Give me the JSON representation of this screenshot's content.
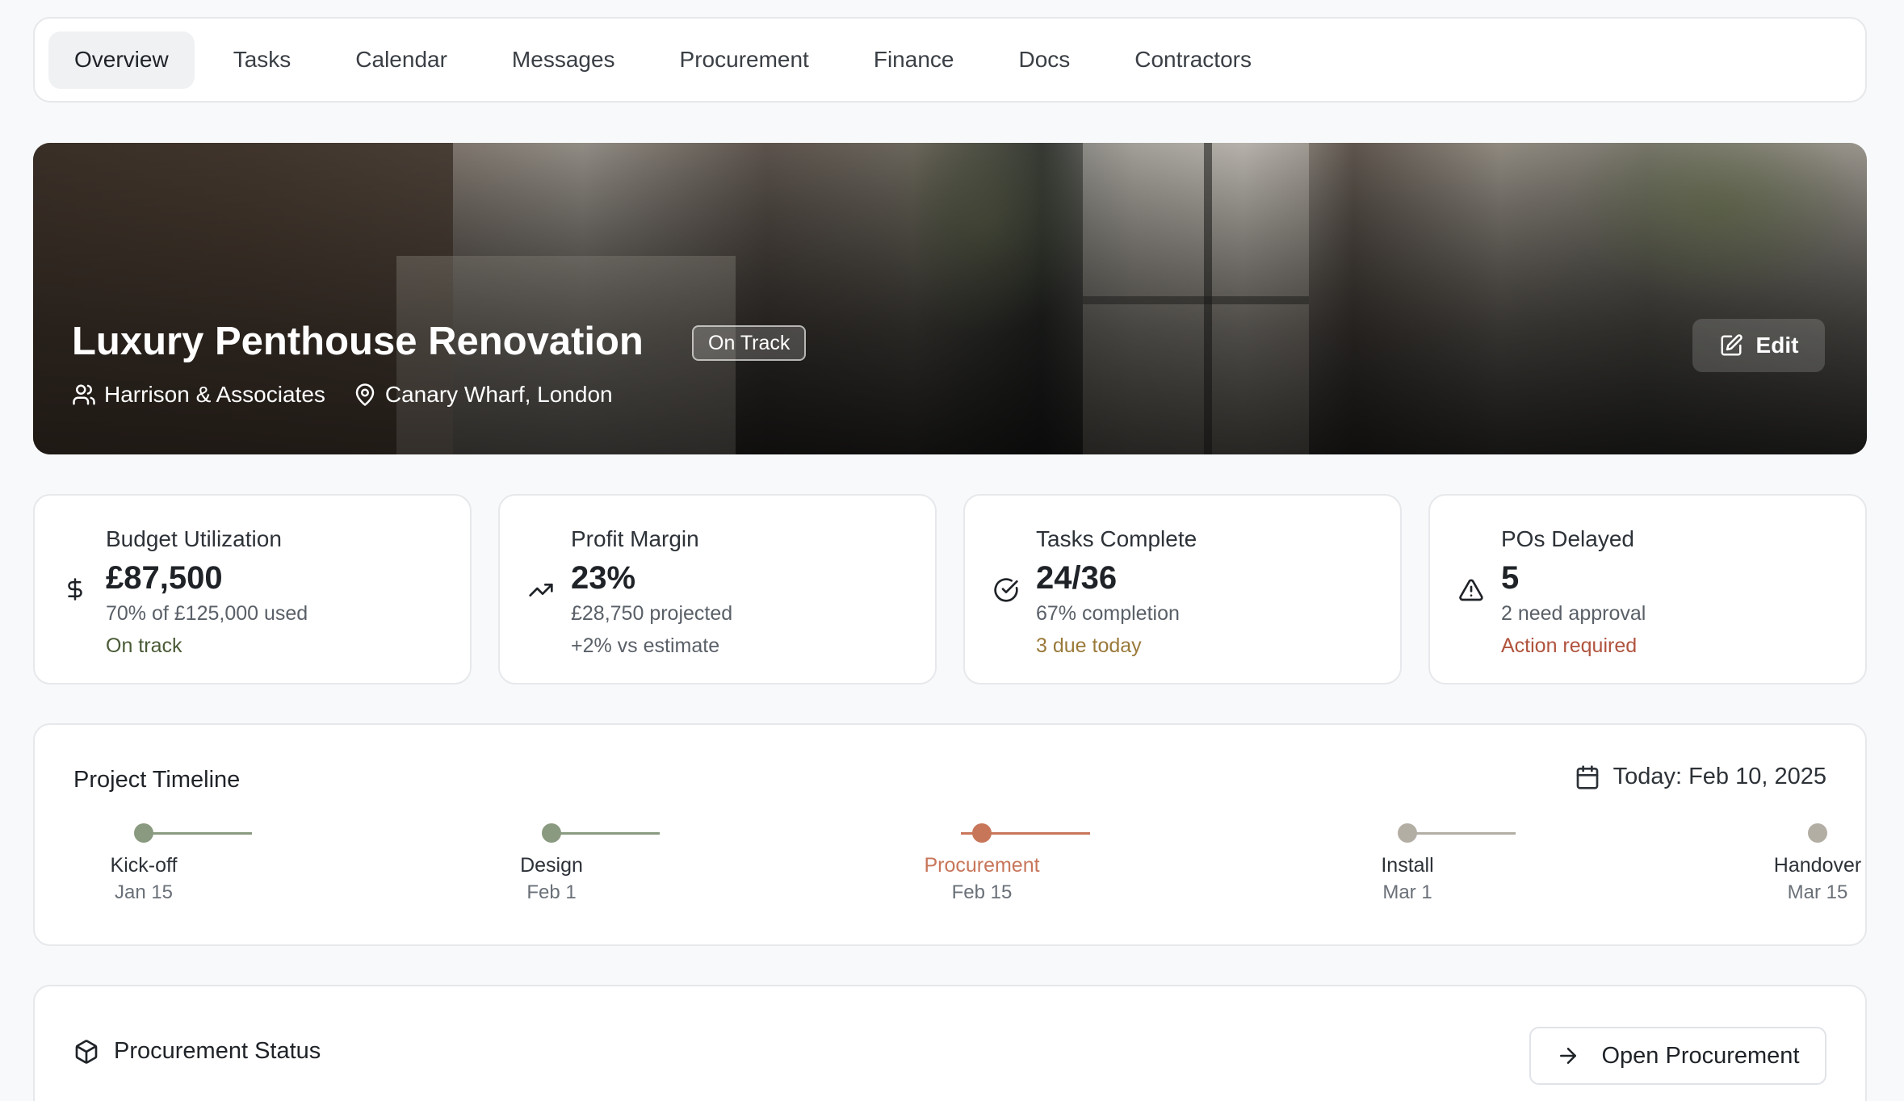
{
  "tabs": [
    {
      "label": "Overview",
      "active": true
    },
    {
      "label": "Tasks"
    },
    {
      "label": "Calendar"
    },
    {
      "label": "Messages"
    },
    {
      "label": "Procurement"
    },
    {
      "label": "Finance"
    },
    {
      "label": "Docs"
    },
    {
      "label": "Contractors"
    }
  ],
  "hero": {
    "title": "Luxury Penthouse Renovation",
    "status": "On Track",
    "client": "Harrison & Associates",
    "location": "Canary Wharf, London",
    "edit_label": "Edit"
  },
  "stats": [
    {
      "icon": "dollar-icon",
      "label": "Budget Utilization",
      "value": "£87,500",
      "sub": "70% of £125,000 used",
      "note": "On track",
      "note_color": "#4a5a36"
    },
    {
      "icon": "trending-up-icon",
      "label": "Profit Margin",
      "value": "23%",
      "sub": "£28,750 projected",
      "note": "+2% vs estimate",
      "note_color": "#5a6068"
    },
    {
      "icon": "check-circle-icon",
      "label": "Tasks Complete",
      "value": "24/36",
      "sub": "67% completion",
      "note": "3 due today",
      "note_color": "#9a7a3a"
    },
    {
      "icon": "warning-icon",
      "label": "POs Delayed",
      "value": "5",
      "sub": "2 need approval",
      "note": "Action required",
      "note_color": "#b0533e"
    }
  ],
  "timeline": {
    "title": "Project Timeline",
    "today": "Today: Feb 10, 2025",
    "milestones": [
      {
        "name": "Kick-off",
        "date": "Jan 15",
        "state": "done"
      },
      {
        "name": "Design",
        "date": "Feb 1",
        "state": "done"
      },
      {
        "name": "Procurement",
        "date": "Feb 15",
        "state": "current"
      },
      {
        "name": "Install",
        "date": "Mar 1",
        "state": "upcoming"
      },
      {
        "name": "Handover",
        "date": "Mar 15",
        "state": "upcoming"
      }
    ],
    "colors": {
      "done": "#8a9a80",
      "current": "#c8765a",
      "upcoming": "#b3aea4"
    }
  },
  "procurement": {
    "title": "Procurement Status",
    "button_label": "Open Procurement"
  }
}
